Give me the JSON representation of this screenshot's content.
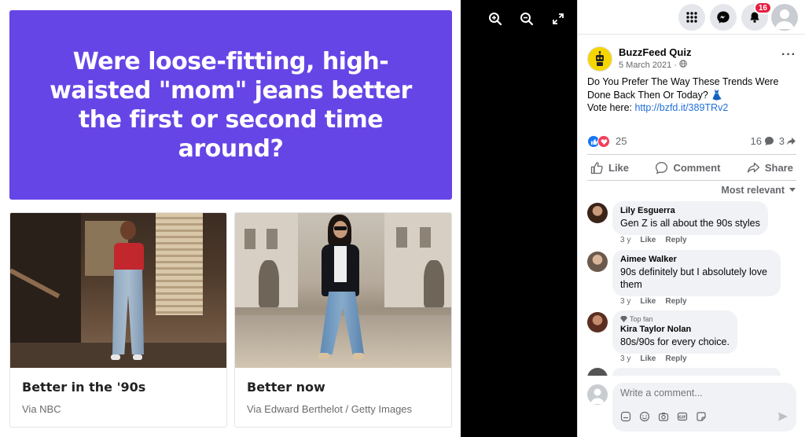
{
  "quiz": {
    "question": "Were loose-fitting, high-waisted \"mom\" jeans better the first or second time around?",
    "options": [
      {
        "label": "Better in the '90s",
        "credit": "Via NBC"
      },
      {
        "label": "Better now",
        "credit": "Via Edward Berthelot / Getty Images"
      }
    ]
  },
  "viewer": {
    "icons": [
      "zoom-in-icon",
      "zoom-out-icon",
      "fullscreen-icon"
    ]
  },
  "topbar": {
    "icons": [
      "menu-grid-icon",
      "messenger-icon",
      "bell-icon",
      "profile-avatar"
    ],
    "notification_count": "16"
  },
  "post": {
    "page_name": "BuzzFeed Quiz",
    "date": "5 March 2021",
    "privacy_icon": "globe-icon",
    "text_line1": "Do You Prefer The Way These Trends Were Done Back Then Or Today? 👗",
    "vote_prefix": "Vote here: ",
    "link": "http://bzfd.it/389TRv2",
    "reaction_count": "25",
    "comment_count": "16",
    "share_count": "3",
    "actions": {
      "like": "Like",
      "comment": "Comment",
      "share": "Share"
    },
    "sort_label": "Most relevant"
  },
  "comments": [
    {
      "name": "Lily Esguerra",
      "text": "Gen Z is all about the 90s styles",
      "time": "3 y",
      "like": "Like",
      "reply": "Reply",
      "badge": ""
    },
    {
      "name": "Aimee Walker",
      "text": "90s definitely but I absolutely love them",
      "time": "3 y",
      "like": "Like",
      "reply": "Reply",
      "badge": ""
    },
    {
      "name": "Kira Taylor Nolan",
      "text": "80s/90s for every choice.",
      "time": "3 y",
      "like": "Like",
      "reply": "Reply",
      "badge": "Top fan"
    }
  ],
  "composer": {
    "placeholder": "Write a comment...",
    "tools": [
      "sticker-icon",
      "emoji-icon",
      "camera-icon",
      "gif-icon",
      "sticker-smile-icon"
    ],
    "send_icon": "send-icon"
  },
  "colors": {
    "quiz_banner": "#6645e6",
    "link": "#216fdb",
    "badge": "#e41e3f",
    "like_blue": "#1877f2",
    "love_red": "#f33e58"
  }
}
